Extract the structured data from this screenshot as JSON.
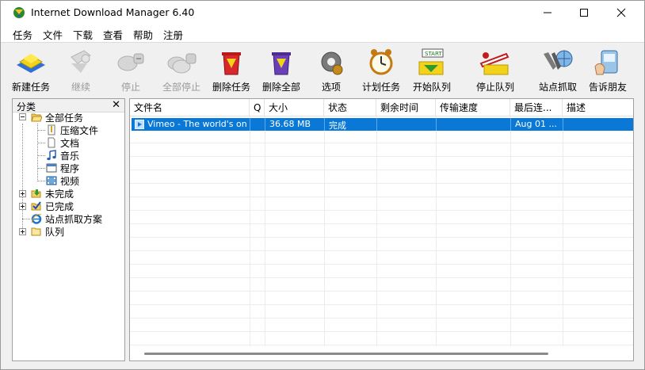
{
  "window": {
    "title": "Internet Download Manager 6.40",
    "controls": {
      "minimize": "minimize",
      "maximize": "maximize",
      "close": "close"
    }
  },
  "menu": [
    "任务",
    "文件",
    "下载",
    "查看",
    "帮助",
    "注册"
  ],
  "toolbar": [
    {
      "label": "新建任务",
      "icon": "new-task-icon",
      "enabled": true
    },
    {
      "label": "继续",
      "icon": "resume-icon",
      "enabled": false
    },
    {
      "label": "停止",
      "icon": "stop-icon",
      "enabled": false
    },
    {
      "label": "全部停止",
      "icon": "stop-all-icon",
      "enabled": false
    },
    {
      "label": "删除任务",
      "icon": "delete-task-icon",
      "enabled": true
    },
    {
      "label": "删除全部",
      "icon": "delete-all-icon",
      "enabled": true
    },
    {
      "label": "选项",
      "icon": "options-gear-icon",
      "enabled": true
    },
    {
      "label": "计划任务",
      "icon": "scheduler-clock-icon",
      "enabled": true
    },
    {
      "label": "开始队列",
      "icon": "start-queue-icon",
      "enabled": true,
      "has_dropdown": true
    },
    {
      "label": "停止队列",
      "icon": "stop-queue-icon",
      "enabled": true,
      "has_dropdown": true
    },
    {
      "label": "站点抓取",
      "icon": "site-grabber-icon",
      "enabled": true
    },
    {
      "label": "告诉朋友",
      "icon": "tell-friend-icon",
      "enabled": true
    }
  ],
  "categories": {
    "header": "分类",
    "close_symbol": "✕",
    "items": [
      {
        "label": "全部任务",
        "icon": "open-folder-icon"
      },
      {
        "label": "压缩文件",
        "icon": "archive-file-icon"
      },
      {
        "label": "文档",
        "icon": "document-icon"
      },
      {
        "label": "音乐",
        "icon": "music-note-icon"
      },
      {
        "label": "程序",
        "icon": "program-window-icon"
      },
      {
        "label": "视频",
        "icon": "video-film-icon"
      },
      {
        "label": "未完成",
        "icon": "unfinished-download-icon"
      },
      {
        "label": "已完成",
        "icon": "finished-check-icon"
      },
      {
        "label": "站点抓取方案",
        "icon": "ie-browser-icon"
      },
      {
        "label": "队列",
        "icon": "queue-folder-icon"
      }
    ]
  },
  "list": {
    "columns": [
      "文件名",
      "Q",
      "大小",
      "状态",
      "剩余时间",
      "传输速度",
      "最后连...",
      "描述"
    ],
    "rows": [
      {
        "filename": "Vimeo - The world's onl...",
        "q": "",
        "size": "36.68  MB",
        "status": "完成",
        "time_left": "",
        "speed": "",
        "last_try": "Aug 01 ...",
        "description": ""
      }
    ]
  },
  "colors": {
    "selection": "#0a78d7",
    "disabled_text": "#9a9a9a"
  }
}
